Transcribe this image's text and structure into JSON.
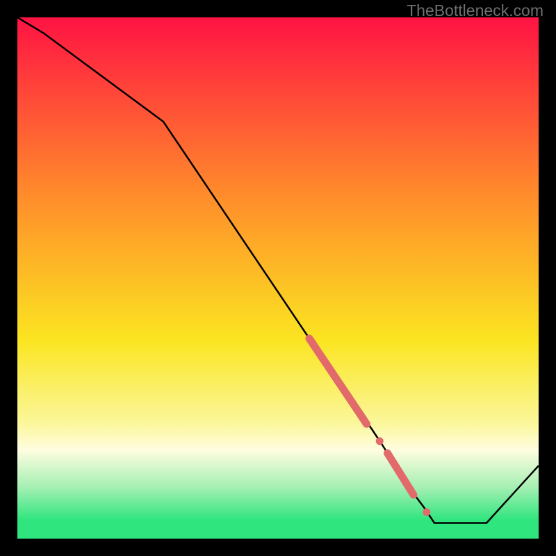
{
  "watermark": "TheBottleneck.com",
  "colors": {
    "frame": "#000000",
    "line": "#000000",
    "marker": "#e26a6a",
    "gradient_top": "#ff1343",
    "gradient_mid1": "#ff8f2a",
    "gradient_mid2": "#fbe521",
    "gradient_yellow_pale": "#fbf79c",
    "gradient_green_pale": "#a7f0b4",
    "gradient_green": "#2ee57e"
  },
  "chart_data": {
    "type": "line",
    "title": "",
    "xlabel": "",
    "ylabel": "",
    "xlim": [
      0,
      100
    ],
    "ylim": [
      0,
      100
    ],
    "series": [
      {
        "name": "bottleneck-curve",
        "x": [
          0,
          5,
          28,
          63,
          68,
          70,
          75,
          78,
          80,
          90,
          100
        ],
        "y": [
          100,
          97,
          80,
          28,
          21,
          18,
          10,
          6,
          3,
          3,
          14
        ]
      }
    ],
    "markers": [
      {
        "name": "highlight-segment-1",
        "type": "thick-segment",
        "x": [
          56,
          67
        ],
        "y": [
          38.4,
          22.0
        ]
      },
      {
        "name": "highlight-dot-1",
        "type": "dot",
        "x": 69.5,
        "y": 18.7
      },
      {
        "name": "highlight-segment-2",
        "type": "thick-segment",
        "x": [
          71,
          76
        ],
        "y": [
          16.4,
          8.4
        ]
      },
      {
        "name": "highlight-dot-2",
        "type": "dot",
        "x": 78.5,
        "y": 5.1
      }
    ],
    "background": {
      "type": "vertical-gradient",
      "stops": [
        {
          "pos": 0.0,
          "color": "#ff1343"
        },
        {
          "pos": 0.35,
          "color": "#ff8f2a"
        },
        {
          "pos": 0.62,
          "color": "#fbe521"
        },
        {
          "pos": 0.78,
          "color": "#fbf79c"
        },
        {
          "pos": 0.83,
          "color": "#fffde0"
        },
        {
          "pos": 0.9,
          "color": "#a7f0b4"
        },
        {
          "pos": 0.965,
          "color": "#2ee57e"
        },
        {
          "pos": 1.0,
          "color": "#2ee57e"
        }
      ]
    }
  }
}
